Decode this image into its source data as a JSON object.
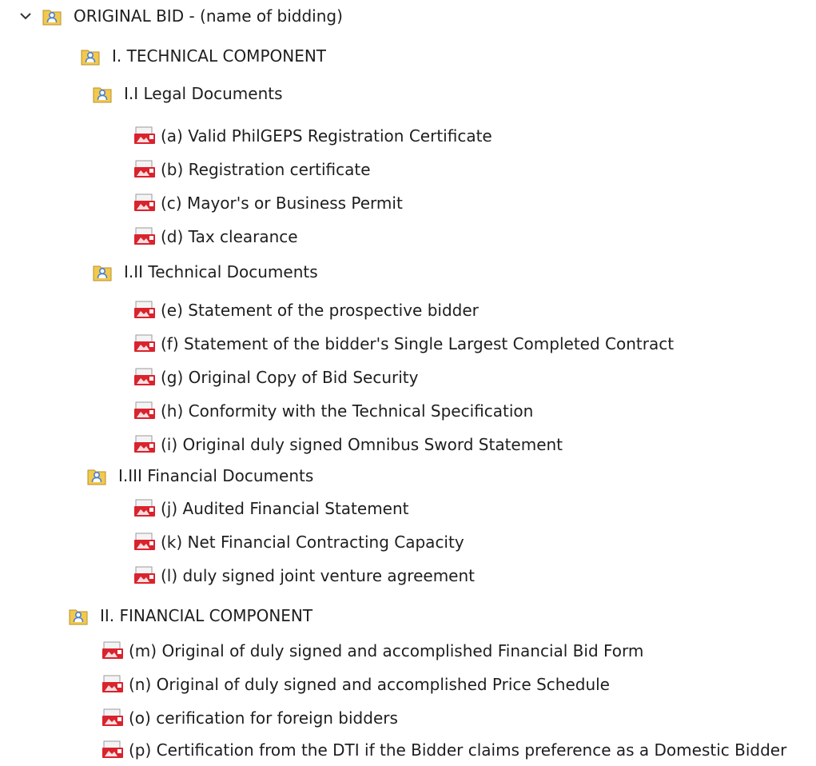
{
  "tree": {
    "root": {
      "label": "ORIGINAL BID - (name of bidding)",
      "expanded": true
    },
    "technical": {
      "label": "I. TECHNICAL COMPONENT"
    },
    "legal": {
      "label": "I.I Legal Documents",
      "items": [
        "(a) Valid PhilGEPS Registration Certificate",
        "(b) Registration certificate",
        "(c) Mayor's or Business Permit",
        "(d) Tax clearance"
      ]
    },
    "techdocs": {
      "label": "I.II Technical Documents",
      "items": [
        "(e) Statement of the prospective bidder",
        "(f) Statement of the bidder's Single Largest Completed Contract",
        "(g) Original Copy of Bid Security",
        "(h) Conformity with the Technical Specification",
        "(i) Original duly signed Omnibus Sword Statement"
      ]
    },
    "findocs": {
      "label": "I.III Financial Documents",
      "items": [
        "(j) Audited Financial Statement",
        "(k) Net Financial Contracting Capacity",
        "(l) duly signed joint venture agreement"
      ]
    },
    "financial": {
      "label": "II. FINANCIAL COMPONENT",
      "items": [
        "(m) Original of duly signed and accomplished Financial Bid Form",
        "(n) Original of duly signed and accomplished Price Schedule",
        "(o) cerification for foreign bidders",
        "(p) Certification from the DTI if the Bidder claims preference as a Domestic Bidder"
      ]
    }
  },
  "icons": {
    "expand": "chevron-down-icon",
    "folder": "shared-folder-icon",
    "file": "pdf-file-icon"
  },
  "colors": {
    "pdf_red": "#d9232d",
    "folder_yellow": "#f2c94c",
    "person_blue": "#4a7fd4",
    "text": "#1e1e1e"
  }
}
